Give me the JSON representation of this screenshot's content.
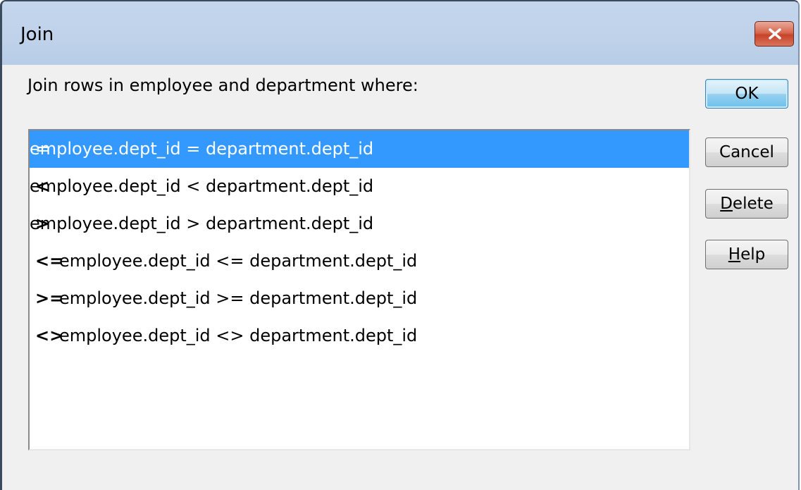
{
  "window": {
    "title": "Join"
  },
  "dialog": {
    "prompt": "Join rows in employee and department where:"
  },
  "conditions": [
    {
      "op": "=",
      "expr": "employee.dept_id = department.dept_id",
      "selected": true
    },
    {
      "op": "<",
      "expr": "employee.dept_id < department.dept_id",
      "selected": false
    },
    {
      "op": ">",
      "expr": "employee.dept_id > department.dept_id",
      "selected": false
    },
    {
      "op": "<=",
      "expr": "employee.dept_id <= department.dept_id",
      "selected": false
    },
    {
      "op": ">=",
      "expr": "employee.dept_id >= department.dept_id",
      "selected": false
    },
    {
      "op": "<>",
      "expr": "employee.dept_id <> department.dept_id",
      "selected": false
    }
  ],
  "buttons": {
    "ok": "OK",
    "cancel": "Cancel",
    "delete_first": "D",
    "delete_rest": "elete",
    "help_first": "H",
    "help_rest": "elp"
  },
  "icons": {
    "close": "close-x-icon"
  },
  "colors": {
    "selection": "#3399ff",
    "titlebar": "#bfd2ea",
    "close_button": "#c7432a",
    "default_button_border": "#3c7fb1"
  }
}
